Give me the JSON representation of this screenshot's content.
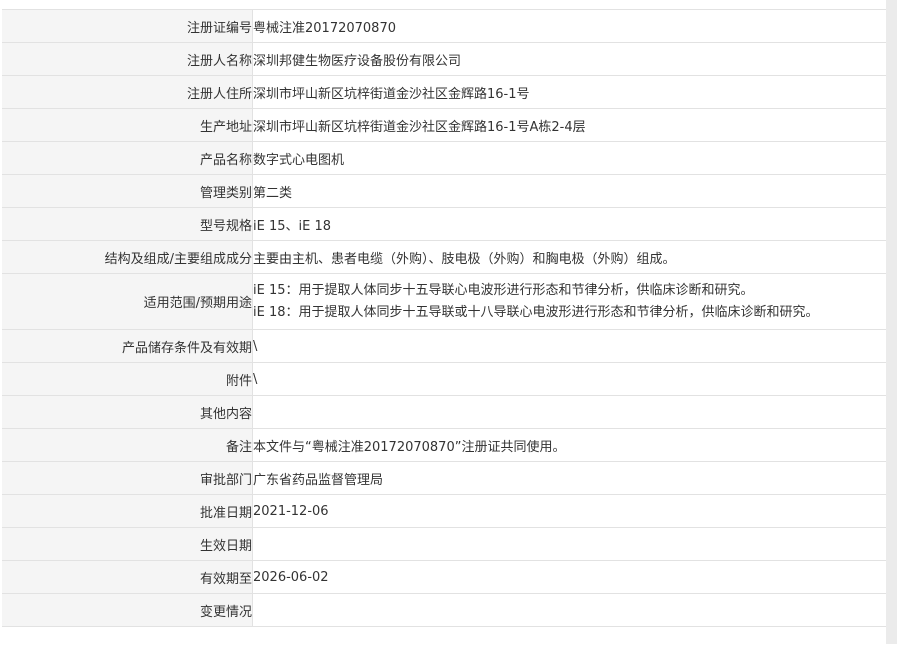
{
  "rows": [
    {
      "label": "注册证编号",
      "value": "粤械注准20172070870"
    },
    {
      "label": "注册人名称",
      "value": "深圳邦健生物医疗设备股份有限公司"
    },
    {
      "label": "注册人住所",
      "value": "深圳市坪山新区坑梓街道金沙社区金辉路16-1号"
    },
    {
      "label": "生产地址",
      "value": "深圳市坪山新区坑梓街道金沙社区金辉路16-1号A栋2-4层"
    },
    {
      "label": "产品名称",
      "value": "数字式心电图机"
    },
    {
      "label": "管理类别",
      "value": "第二类"
    },
    {
      "label": "型号规格",
      "value": "iE 15、iE 18"
    },
    {
      "label": "结构及组成/主要组成成分",
      "value": "主要由主机、患者电缆（外购）、肢电极（外购）和胸电极（外购）组成。"
    },
    {
      "label": "适用范围/预期用途",
      "value_lines": [
        "iE 15：用于提取人体同步十五导联心电波形进行形态和节律分析，供临床诊断和研究。",
        "iE 18：用于提取人体同步十五导联或十八导联心电波形进行形态和节律分析，供临床诊断和研究。"
      ]
    },
    {
      "label": "产品储存条件及有效期",
      "value": "\\"
    },
    {
      "label": "附件",
      "value": "\\"
    },
    {
      "label": "其他内容",
      "value": ""
    },
    {
      "label": "备注",
      "value": "本文件与“粤械注准20172070870”注册证共同使用。"
    },
    {
      "label": "审批部门",
      "value": "广东省药品监督管理局"
    },
    {
      "label": "批准日期",
      "value": "2021-12-06"
    },
    {
      "label": "生效日期",
      "value": ""
    },
    {
      "label": "有效期至",
      "value": "2026-06-02"
    },
    {
      "label": "变更情况",
      "value": ""
    }
  ]
}
